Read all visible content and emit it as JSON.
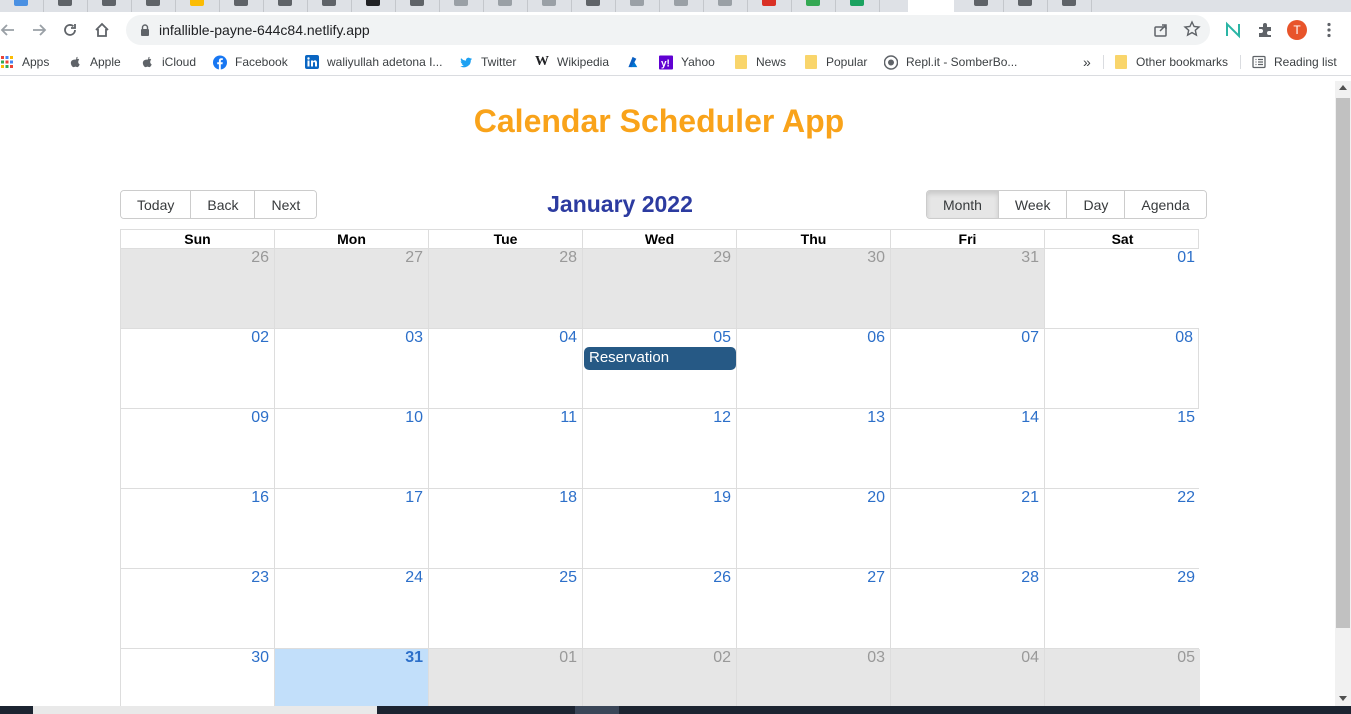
{
  "browser": {
    "url": "infallible-payne-644c84.netlify.app",
    "profile_initial": "T",
    "bookmarks": [
      {
        "label": "Apps",
        "icon": "apps-grid-icon"
      },
      {
        "label": "Apple",
        "icon": "apple-icon"
      },
      {
        "label": "iCloud",
        "icon": "apple-icon"
      },
      {
        "label": "Facebook",
        "icon": "facebook-icon"
      },
      {
        "label": "waliyullah adetona I...",
        "icon": "linkedin-icon"
      },
      {
        "label": "Twitter",
        "icon": "twitter-icon"
      },
      {
        "label": "Wikipedia",
        "icon": "wikipedia-icon"
      },
      {
        "label": "",
        "icon": "azure-icon"
      },
      {
        "label": "Yahoo",
        "icon": "yahoo-icon"
      },
      {
        "label": "News",
        "icon": "folder-icon"
      },
      {
        "label": "Popular",
        "icon": "folder-icon"
      },
      {
        "label": "Repl.it - SomberBo...",
        "icon": "replit-icon"
      }
    ],
    "more_bookmarks": "»",
    "other_bookmarks": "Other bookmarks",
    "reading_list": "Reading list"
  },
  "app": {
    "title": "Calendar Scheduler App",
    "nav_buttons": [
      "Today",
      "Back",
      "Next"
    ],
    "month_label": "January 2022",
    "view_buttons": [
      "Month",
      "Week",
      "Day",
      "Agenda"
    ],
    "active_view": "Month",
    "weekdays": [
      "Sun",
      "Mon",
      "Tue",
      "Wed",
      "Thu",
      "Fri",
      "Sat"
    ],
    "weeks": [
      [
        "26",
        "27",
        "28",
        "29",
        "30",
        "31",
        "01"
      ],
      [
        "02",
        "03",
        "04",
        "05",
        "06",
        "07",
        "08"
      ],
      [
        "09",
        "10",
        "11",
        "12",
        "13",
        "14",
        "15"
      ],
      [
        "16",
        "17",
        "18",
        "19",
        "20",
        "21",
        "22"
      ],
      [
        "23",
        "24",
        "25",
        "26",
        "27",
        "28",
        "29"
      ],
      [
        "30",
        "31",
        "01",
        "02",
        "03",
        "04",
        "05"
      ]
    ],
    "today": "31",
    "event": {
      "title": "Reservation",
      "date": "05"
    },
    "colors": {
      "title": "#f9a31a",
      "month_label": "#2c3ba0",
      "date_number": "#2c6fc9",
      "off_range_bg": "#e6e6e6",
      "today_bg": "#c2dffa",
      "event_bg": "#265985"
    }
  }
}
